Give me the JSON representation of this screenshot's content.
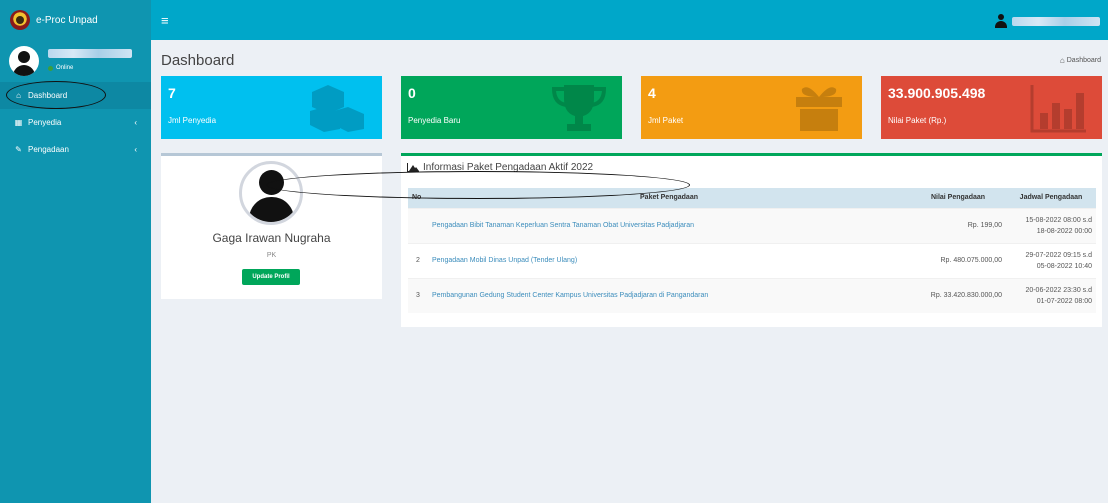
{
  "app": {
    "title": "e-Proc Unpad"
  },
  "sidebar": {
    "user_status": "Online",
    "items": [
      {
        "label": "Dashboard",
        "icon": "dashboard-icon",
        "active": true
      },
      {
        "label": "Penyedia",
        "icon": "calendar-icon",
        "has_submenu": true
      },
      {
        "label": "Pengadaan",
        "icon": "edit-icon",
        "has_submenu": true
      }
    ],
    "chevron": "‹"
  },
  "header": {
    "menu_toggle": "≡"
  },
  "page": {
    "title": "Dashboard",
    "breadcrumb": "Dashboard"
  },
  "stats": [
    {
      "value": "7",
      "label": "Jml Penyedia",
      "color": "#00c0ef",
      "icon": "cubes-icon"
    },
    {
      "value": "0",
      "label": "Penyedia Baru",
      "color": "#00a65a",
      "icon": "trophy-icon"
    },
    {
      "value": "4",
      "label": "Jml Paket",
      "color": "#f39c12",
      "icon": "gift-icon"
    },
    {
      "value": "33.900.905.498",
      "label": "Nilai Paket (Rp.)",
      "color": "#dd4b39",
      "icon": "bar-chart-icon"
    }
  ],
  "profile": {
    "name": "Gaga Irawan Nugraha",
    "role": "PK",
    "button": "Update Profil"
  },
  "packages": {
    "title": "Informasi Paket Pengadaan Aktif 2022",
    "columns": [
      "No",
      "Paket Pengadaan",
      "Nilai Pengadaan",
      "Jadwal Pengadaan"
    ],
    "rows": [
      {
        "no": "",
        "paket": "Pengadaan Bibit Tanaman Keperluan Sentra Tanaman Obat Universitas Padjadjaran",
        "nilai": "Rp. 199,00",
        "jadwal_1": "15-08-2022 08:00 s.d",
        "jadwal_2": "18-08-2022 00:00"
      },
      {
        "no": "2",
        "paket": "Pengadaan Mobil Dinas Unpad (Tender Ulang)",
        "nilai": "Rp. 480.075.000,00",
        "jadwal_1": "29-07-2022 09:15 s.d",
        "jadwal_2": "05-08-2022 10:40"
      },
      {
        "no": "3",
        "paket": "Pembangunan Gedung Student Center Kampus Universitas Padjadjaran di Pangandaran",
        "nilai": "Rp. 33.420.830.000,00",
        "jadwal_1": "20-06-2022 23:30 s.d",
        "jadwal_2": "01-07-2022 08:00"
      }
    ]
  }
}
